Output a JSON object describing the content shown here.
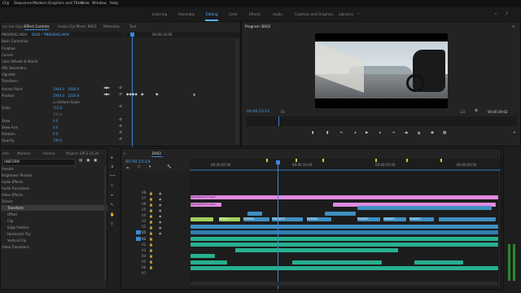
{
  "menu": [
    "Clip",
    "Sequence",
    "Markers",
    "Graphics and Titles",
    "View",
    "Window",
    "Help"
  ],
  "workspaces": [
    "Learning",
    "Assembly",
    "Editing",
    "Color",
    "Effects",
    "Audio",
    "Captions and Graphics",
    "Libraries"
  ],
  "active_workspace": "Editing",
  "effect_controls": {
    "tabs": [
      "ce: (no clips)",
      "Effect Controls",
      "Audio Clip Mixer: BX02",
      "Metadata",
      "Text"
    ],
    "clip_path": "BX02 * PN000002.MOV",
    "master_path": "PN000002.MOV",
    "left_list": [
      "Basic Correction",
      "Creative",
      "Curves",
      "Color Wheels & Match",
      "HSL Secondary",
      "Vignette"
    ],
    "section": "Transform",
    "timecode": "00:00:14:00",
    "properties": [
      {
        "label": "Anchor Point",
        "v1": "1940.0",
        "v2": "1080.0"
      },
      {
        "label": "Position",
        "v1": "1940.0",
        "v2": "1020.8"
      },
      {
        "label": "",
        "v1": "Uniform Scale",
        "v2": ""
      },
      {
        "label": "Scale",
        "v1": "115.0",
        "v2": ""
      },
      {
        "label": "",
        "v1": "100.0",
        "v2": ""
      },
      {
        "label": "Skew",
        "v1": "0.0",
        "v2": ""
      },
      {
        "label": "Skew Axis",
        "v1": "0.0",
        "v2": ""
      },
      {
        "label": "Rotation",
        "v1": "0.0",
        "v2": ""
      },
      {
        "label": "Opacity",
        "v1": "100.0",
        "v2": ""
      }
    ]
  },
  "program": {
    "title": "Program: BX02",
    "timecode": "00:00:13:14",
    "fit": "Fit",
    "resolution": "1/2",
    "duration": "00:00:39:02"
  },
  "project": {
    "tabs": [
      "Info",
      "Markers",
      "History",
      "Project: EPLS 10 20"
    ],
    "search": "UNIFORM",
    "items": [
      "Presets",
      "Brightness Presets",
      "Audio Effects",
      "Audio Transitions",
      "Video Effects",
      "Distort",
      "Transform",
      "Offset",
      "Clip",
      "Edge Feather",
      "Horizontal Flip",
      "Vertical Flip",
      "Video Transitions"
    ],
    "selected": "Transform"
  },
  "timeline": {
    "title": "BX02",
    "timecode": "00:00:13:14",
    "ruler": [
      "00:00:05:00",
      "00:00:10:00",
      "00:00:15:00",
      "00:00:20:00"
    ],
    "video_tracks": [
      "V8",
      "V7",
      "V6",
      "V5",
      "V4",
      "V3",
      "V2",
      "V1"
    ],
    "audio_tracks": [
      "A1",
      "A2",
      "A3",
      "A4",
      "A5",
      "A6",
      "A7"
    ],
    "clips_top": [
      "Adjustment Layer",
      "Adjustment Layer"
    ],
    "clips_mid": [
      "TRACK",
      "PN0004",
      "PN00002",
      "PN0002",
      "PN0003",
      "PN0003",
      "PN0005"
    ]
  },
  "colors": {
    "accent": "#3a86d6",
    "clip_video": "#3f8fc0",
    "clip_adjust": "#e08ae0",
    "clip_audio": "#27b090",
    "clip_green": "#9fcf5a",
    "marker": "#c9d238"
  }
}
